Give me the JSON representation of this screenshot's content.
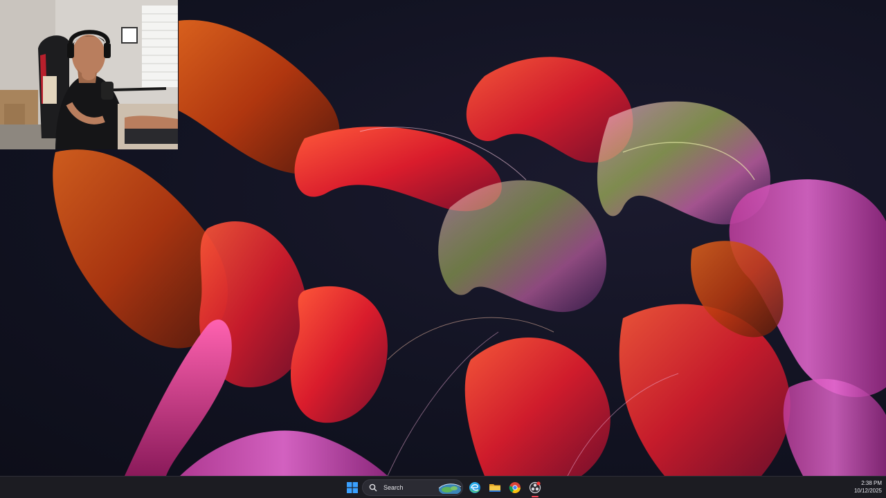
{
  "taskbar": {
    "search_label": "Search",
    "pinned_apps": [
      "start-icon",
      "edge-icon",
      "file-explorer-icon",
      "chrome-icon",
      "obs-icon"
    ],
    "clock": {
      "time": "2:38 PM",
      "date": "10/12/2025"
    }
  },
  "colors": {
    "desktop_background": "#121322",
    "taskbar_background": "#1c1c22",
    "start_blue": "#3aa0ff",
    "active_app_indicator": "#ff4a5a"
  },
  "desktop": {
    "wallpaper": "ribbon-wallpaper"
  },
  "webcam_overlay": {
    "subject": "person-with-headphones"
  }
}
